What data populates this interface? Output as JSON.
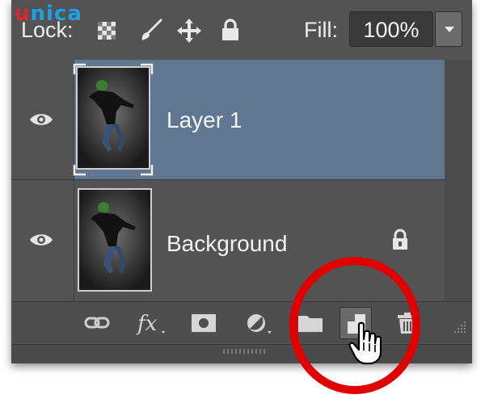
{
  "brand": {
    "text": "unica",
    "first_letter": "u",
    "rest": "nica",
    "colors": {
      "u": "#e0262b",
      "rest": "#1da1e6"
    }
  },
  "lock_bar": {
    "lock_label": "Lock:",
    "lock_icons": [
      "lock-transparent-pixels-icon",
      "lock-image-pixels-icon",
      "lock-position-icon",
      "lock-all-icon"
    ],
    "fill_label": "Fill:",
    "fill_value": "100%"
  },
  "layers": [
    {
      "name": "Layer 1",
      "visible": true,
      "selected": true,
      "locked": false,
      "thumbnail": "jumping-dancer-photo"
    },
    {
      "name": "Background",
      "visible": true,
      "selected": false,
      "locked": true,
      "thumbnail": "jumping-dancer-photo"
    }
  ],
  "toolbar": {
    "buttons": [
      {
        "name": "link-layers-icon"
      },
      {
        "name": "add-layer-style-icon",
        "label": "fx"
      },
      {
        "name": "add-layer-mask-icon"
      },
      {
        "name": "new-adjustment-layer-icon"
      },
      {
        "name": "new-group-icon"
      },
      {
        "name": "new-layer-icon",
        "highlighted": true
      },
      {
        "name": "delete-layer-icon"
      }
    ]
  },
  "annotation": {
    "type": "red-circle-highlight",
    "color": "#e00000",
    "target": "new-layer-icon"
  },
  "colors": {
    "panel": "#535353",
    "selected_row": "#607792",
    "text": "#f3f3f3"
  }
}
